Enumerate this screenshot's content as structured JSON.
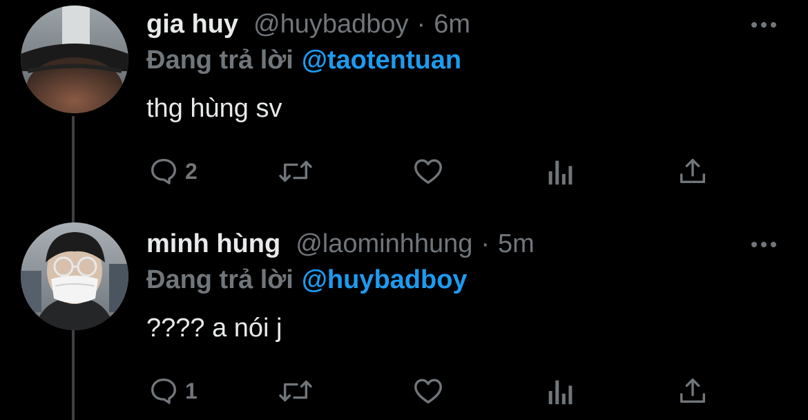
{
  "tweets": [
    {
      "display_name": "gia huy",
      "handle": "@huybadboy",
      "separator": "·",
      "time": "6m",
      "replying_label": "Đang trả lời",
      "replying_to": "@taotentuan",
      "text": "thg hùng sv",
      "reply_count": "2",
      "avatar_icon": "avatar-photo-cap",
      "icons": [
        "reply-icon",
        "retweet-icon",
        "like-icon",
        "analytics-icon",
        "share-icon",
        "more-icon"
      ]
    },
    {
      "display_name": "minh hùng",
      "handle": "@laominhhung",
      "separator": "·",
      "time": "5m",
      "replying_label": "Đang trả lời",
      "replying_to": "@huybadboy",
      "text": "???? a nói j",
      "reply_count": "1",
      "avatar_icon": "avatar-photo-mask",
      "icons": [
        "reply-icon",
        "retweet-icon",
        "like-icon",
        "analytics-icon",
        "share-icon",
        "more-icon"
      ]
    }
  ],
  "colors": {
    "background": "#000000",
    "primary_text": "#e7e9ea",
    "secondary_text": "#71767b",
    "link": "#1d9bf0",
    "thread_line": "#3e4144"
  }
}
